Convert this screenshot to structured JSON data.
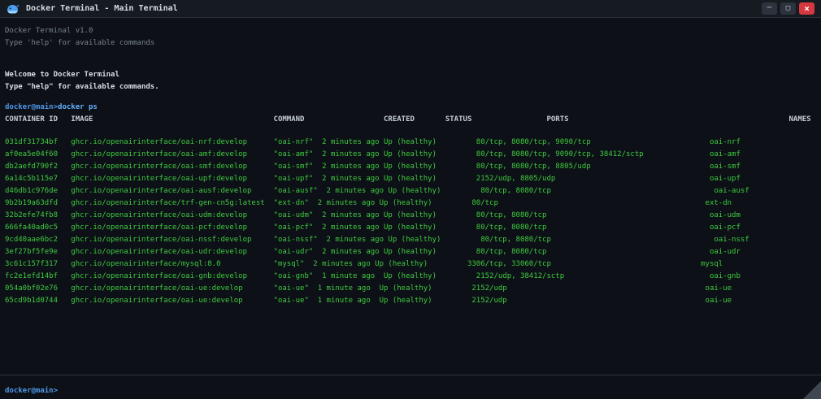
{
  "window": {
    "title": "Docker Terminal - Main Terminal",
    "controls": {
      "minimize_glyph": "─",
      "maximize_glyph": "□",
      "close_glyph": "×"
    }
  },
  "banner": [
    "Docker Terminal v1.0",
    "Type 'help' for available commands"
  ],
  "welcome": [
    "Welcome to Docker Terminal",
    "Type \"help\" for available commands."
  ],
  "session": {
    "prompt": "docker@main>",
    "command": "docker ps"
  },
  "table": {
    "headers": [
      "CONTAINER ID",
      "IMAGE",
      "COMMAND",
      "CREATED",
      "STATUS",
      "PORTS",
      "NAMES"
    ],
    "rows": [
      {
        "id": "031df31734bf",
        "image": "ghcr.io/openairinterface/oai-nrf:develop",
        "command": "\"oai-nrf\"",
        "created": "2 minutes ago",
        "status": "Up (healthy)",
        "ports": "80/tcp, 8080/tcp, 9090/tcp",
        "name": "oai-nrf"
      },
      {
        "id": "af0ea5e04f60",
        "image": "ghcr.io/openairinterface/oai-amf:develop",
        "command": "\"oai-amf\"",
        "created": "2 minutes ago",
        "status": "Up (healthy)",
        "ports": "80/tcp, 8080/tcp, 9090/tcp, 38412/sctp",
        "name": "oai-amf"
      },
      {
        "id": "db2aefd790f2",
        "image": "ghcr.io/openairinterface/oai-smf:develop",
        "command": "\"oai-smf\"",
        "created": "2 minutes ago",
        "status": "Up (healthy)",
        "ports": "80/tcp, 8080/tcp, 8805/udp",
        "name": "oai-smf"
      },
      {
        "id": "6a14c5b115e7",
        "image": "ghcr.io/openairinterface/oai-upf:develop",
        "command": "\"oai-upf\"",
        "created": "2 minutes ago",
        "status": "Up (healthy)",
        "ports": "2152/udp, 8805/udp",
        "name": "oai-upf"
      },
      {
        "id": "d46db1c976de",
        "image": "ghcr.io/openairinterface/oai-ausf:develop",
        "command": "\"oai-ausf\"",
        "created": "2 minutes ago",
        "status": "Up (healthy)",
        "ports": "80/tcp, 8080/tcp",
        "name": "oai-ausf"
      },
      {
        "id": "9b2b19a63dfd",
        "image": "ghcr.io/openairinterface/trf-gen-cn5g:latest",
        "command": "\"ext-dn\"",
        "created": "2 minutes ago",
        "status": "Up (healthy)",
        "ports": "80/tcp",
        "name": "ext-dn"
      },
      {
        "id": "32b2efe74fb8",
        "image": "ghcr.io/openairinterface/oai-udm:develop",
        "command": "\"oai-udm\"",
        "created": "2 minutes ago",
        "status": "Up (healthy)",
        "ports": "80/tcp, 8080/tcp",
        "name": "oai-udm"
      },
      {
        "id": "666fa40ad0c5",
        "image": "ghcr.io/openairinterface/oai-pcf:develop",
        "command": "\"oai-pcf\"",
        "created": "2 minutes ago",
        "status": "Up (healthy)",
        "ports": "80/tcp, 8080/tcp",
        "name": "oai-pcf"
      },
      {
        "id": "9cd40aae6bc2",
        "image": "ghcr.io/openairinterface/oai-nssf:develop",
        "command": "\"oai-nssf\"",
        "created": "2 minutes ago",
        "status": "Up (healthy)",
        "ports": "80/tcp, 8080/tcp",
        "name": "oai-nssf"
      },
      {
        "id": "3ef27bf5fe9e",
        "image": "ghcr.io/openairinterface/oai-udr:develop",
        "command": "\"oai-udr\"",
        "created": "2 minutes ago",
        "status": "Up (healthy)",
        "ports": "80/tcp, 8080/tcp",
        "name": "oai-udr"
      },
      {
        "id": "3c61c157f317",
        "image": "ghcr.io/openairinterface/mysql:8.0",
        "command": "\"mysql\"",
        "created": "2 minutes ago",
        "status": "Up (healthy)",
        "ports": "3306/tcp, 33060/tcp",
        "name": "mysql"
      },
      {
        "id": "fc2e1efd14bf",
        "image": "ghcr.io/openairinterface/oai-gnb:develop",
        "command": "\"oai-gnb\"",
        "created": "1 minute ago",
        "status": "Up (healthy)",
        "ports": "2152/udp, 38412/sctp",
        "name": "oai-gnb"
      },
      {
        "id": "054a0bf02e76",
        "image": "ghcr.io/openairinterface/oai-ue:develop",
        "command": "\"oai-ue\"",
        "created": "1 minute ago",
        "status": "Up (healthy)",
        "ports": "2152/udp",
        "name": "oai-ue"
      },
      {
        "id": "65cd9b1d0744",
        "image": "ghcr.io/openairinterface/oai-ue:develop",
        "command": "\"oai-ue\"",
        "created": "1 minute ago",
        "status": "Up (healthy)",
        "ports": "2152/udp",
        "name": "oai-ue"
      }
    ]
  },
  "input": {
    "prompt": "docker@main>"
  },
  "colors": {
    "background": "#0d1117",
    "titlebar": "#161b22",
    "border": "#2b3138",
    "dim_text": "#7a828c",
    "bright_text": "#d7dde3",
    "header_text": "#c6cdd5",
    "prompt_blue": "#4f97e8",
    "command_blue": "#64b1ff",
    "output_green": "#3fca3f",
    "close_red": "#d5383f",
    "button_gray": "#2d333c",
    "grip": "#3f4750"
  }
}
